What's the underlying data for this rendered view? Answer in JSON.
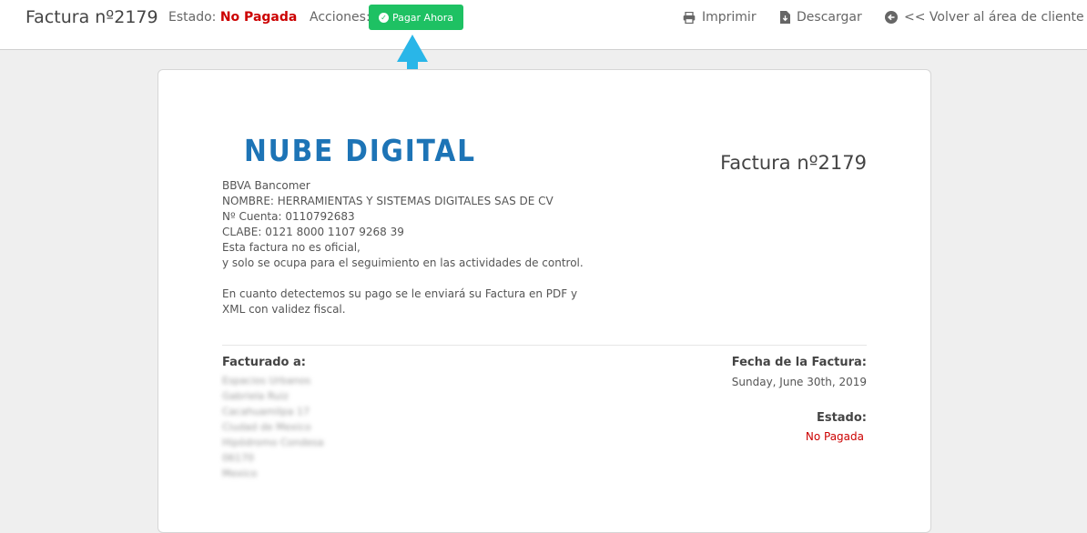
{
  "header": {
    "title": "Factura nº2179",
    "status_label": "Estado:",
    "status_value": "No Pagada",
    "actions_label": "Acciones:",
    "pay_button": "Pagar Ahora",
    "print_label": "Imprimir",
    "download_label": "Descargar",
    "back_label": "<< Volver al área de cliente"
  },
  "invoice": {
    "logo_text": "NUBE DIGITAL",
    "title": "Factura nº2179",
    "pay_to_lines": [
      "BBVA Bancomer",
      "NOMBRE: HERRAMIENTAS Y SISTEMAS DIGITALES SAS DE CV",
      "Nº Cuenta: 0110792683",
      "CLABE: 0121 8000 1107 9268 39",
      "Esta factura no es oficial,",
      "y solo se ocupa para el seguimiento en las actividades de control.",
      "",
      "En cuanto detectemos su pago se le enviará su Factura en PDF y",
      "XML con validez fiscal."
    ],
    "billed_to_label": "Facturado a:",
    "billed_to_lines": [
      "Espacios Urbanos",
      "Gabriela Ruiz",
      "Cacahuamilpa 17",
      "Ciudad de Mexico",
      "Hipódromo Condesa",
      "06170",
      "Mexico"
    ],
    "date_label": "Fecha de la Factura:",
    "date_value": "Sunday, June 30th, 2019",
    "status_label": "Estado:",
    "status_value": "No Pagada"
  },
  "colors": {
    "accent_green": "#1ec163",
    "unpaid_red": "#cc0000",
    "logo_blue": "#1d74b6",
    "arrow_blue": "#29b6e8"
  },
  "icons": {
    "pay": "check-circle-icon",
    "print": "printer-icon",
    "download": "file-download-icon",
    "back": "arrow-circle-left-icon",
    "annotation": "up-arrow-icon"
  }
}
